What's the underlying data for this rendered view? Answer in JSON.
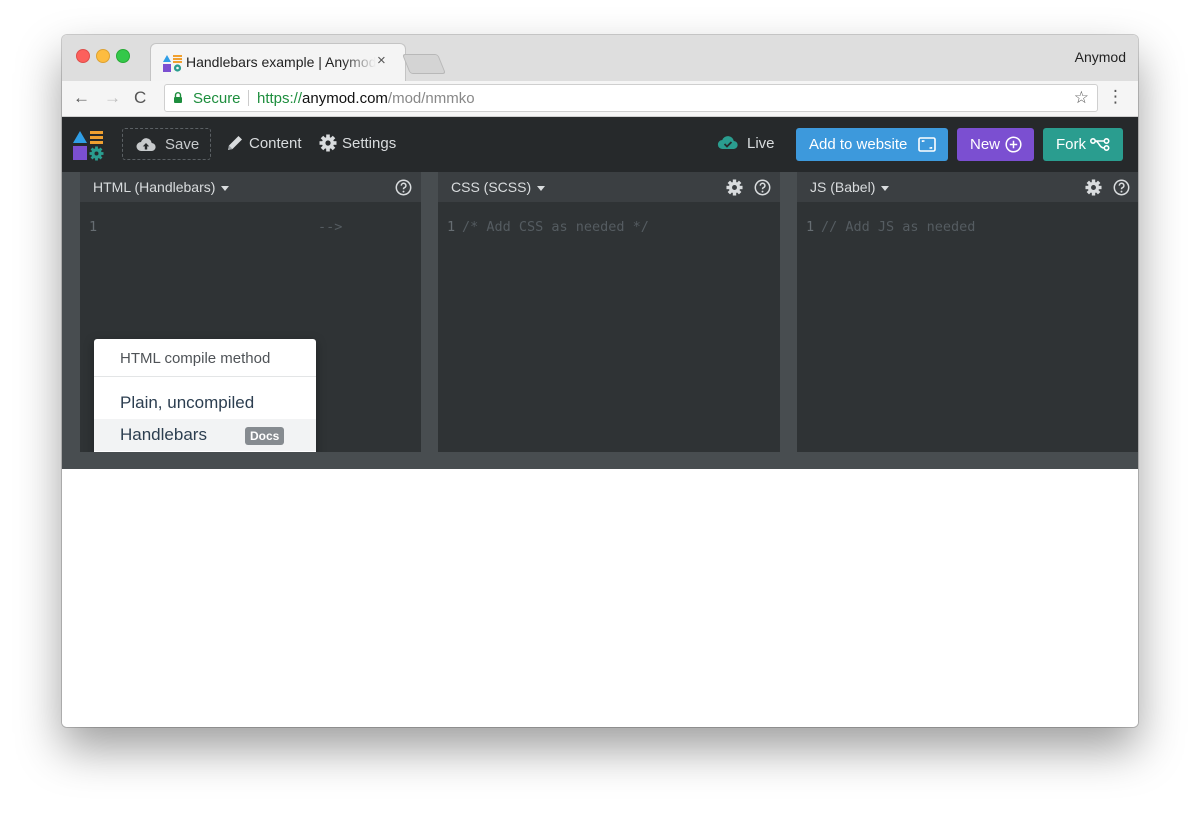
{
  "browser": {
    "tab_title": "Handlebars example | Anymod",
    "tab_close": "×",
    "profile_name": "Anymod",
    "security_label": "Secure",
    "url_scheme": "https://",
    "url_host": "anymod.com",
    "url_path": "/mod/nmmko",
    "nav_back": "←",
    "nav_forward": "→",
    "nav_reload": "C",
    "bookmark_star": "☆",
    "menu_kebab": "⋮"
  },
  "app_bar": {
    "save_label": "Save",
    "content_label": "Content",
    "settings_label": "Settings",
    "live_label": "Live",
    "add_to_website_label": "Add to website",
    "new_label": "New",
    "fork_label": "Fork"
  },
  "editors": {
    "html": {
      "title": "HTML (Handlebars)",
      "line_number": "1",
      "code": "-->"
    },
    "css": {
      "title": "CSS (SCSS)",
      "line_number": "1",
      "code": "/* Add CSS as needed */"
    },
    "js": {
      "title": "JS (Babel)",
      "line_number": "1",
      "code": "// Add JS as needed"
    }
  },
  "dropdown": {
    "header": "HTML compile method",
    "items": [
      {
        "label": "Plain, uncompiled"
      },
      {
        "label": "Handlebars",
        "badge": "Docs"
      }
    ]
  },
  "colors": {
    "topbar_bg": "#26292b",
    "editor_bg": "#2f3335",
    "add_button": "#3d99dc",
    "new_button": "#7b4fd1",
    "fork_button": "#2a9d8f",
    "secure_green": "#1e8e3e"
  },
  "icons": {
    "save": "cloud-upload-icon",
    "content": "pencil-icon",
    "settings": "gear-icon",
    "live": "cloud-check-icon",
    "add": "embed-window-icon",
    "new": "plus-circle-icon",
    "fork": "fork-icon",
    "help": "question-circle-icon"
  }
}
